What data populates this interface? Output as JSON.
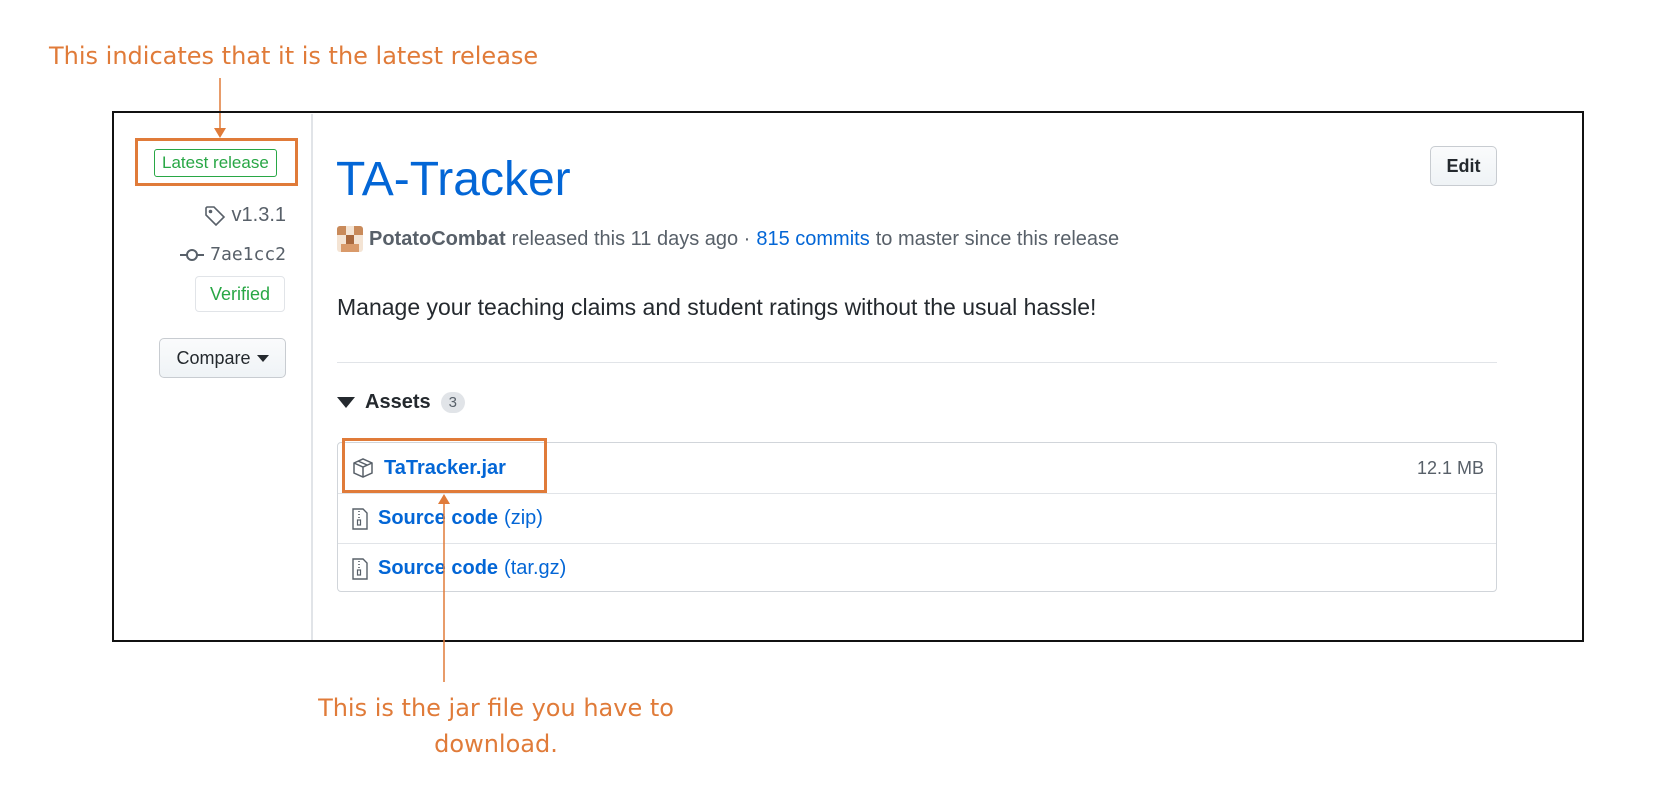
{
  "annotations": {
    "top": "This indicates that it is the latest release",
    "bottom": "This is the jar file you have to download."
  },
  "sidebar": {
    "badge": "Latest release",
    "tag": "v1.3.1",
    "commit": "7ae1cc2",
    "verified": "Verified",
    "compare": "Compare"
  },
  "release": {
    "title": "TA-Tracker",
    "edit": "Edit",
    "author": "PotatoCombat",
    "released_text": "released this 11 days ago ·",
    "commits_link": "815 commits",
    "commits_suffix": "to master since this release",
    "description": "Manage your teaching claims and student ratings without the usual hassle!"
  },
  "assets": {
    "heading": "Assets",
    "count": "3",
    "items": [
      {
        "name": "TaTracker.jar",
        "ext": "",
        "size": "12.1 MB",
        "icon": "package-icon"
      },
      {
        "name": "Source code",
        "ext": "(zip)",
        "size": "",
        "icon": "file-zip-icon"
      },
      {
        "name": "Source code",
        "ext": "(tar.gz)",
        "size": "",
        "icon": "file-zip-icon"
      }
    ]
  },
  "colors": {
    "accent_annotation": "#e07b39",
    "link": "#0366d6",
    "verified_green": "#28a745"
  }
}
